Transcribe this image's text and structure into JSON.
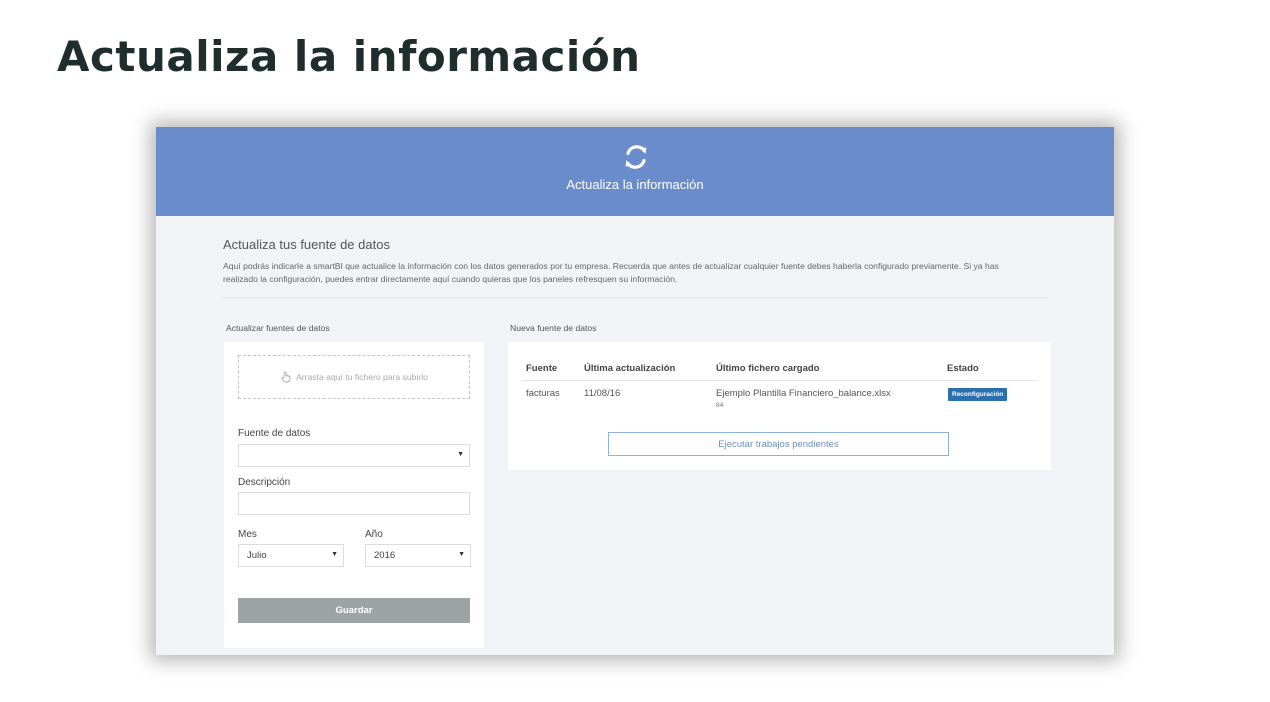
{
  "slide": {
    "title": "Actualiza la información"
  },
  "header": {
    "icon": "refresh-icon",
    "title": "Actualiza la información",
    "bg_color": "#6b8ccb"
  },
  "intro": {
    "title": "Actualiza tus fuente de datos",
    "text": "Aquí podrás indicarle a smartBI que actualice la información con los datos generados por tu empresa. Recuerda que antes de actualizar cualquier fuente debes haberla configurado previamente. Si ya has realizado la configuración, puedes entrar directamente aquí cuando quieras que los paneles refresquen su información."
  },
  "upload_panel": {
    "label": "Actualizar fuentes de datos",
    "dropzone_icon": "hand-pointer-icon",
    "dropzone_text": "Arrasta aquí tu fichero para subirlo",
    "source_label": "Fuente de datos",
    "source_value": "",
    "description_label": "Descripción",
    "description_value": "",
    "month_label": "Mes",
    "month_value": "Julio",
    "year_label": "Año",
    "year_value": "2016",
    "save_label": "Guardar"
  },
  "sources_panel": {
    "label": "Nueva fuente de datos",
    "columns": [
      "Fuente",
      "Última actualización",
      "Último fichero cargado",
      "Estado"
    ],
    "rows": [
      {
        "source": "facturas",
        "updated": "11/08/16",
        "file": "Ejemplo Plantilla Financiero_balance.xlsx",
        "file_sub": "84",
        "status": "Reconfiguración"
      }
    ],
    "run_label": "Ejecutar trabajos pendientes"
  }
}
